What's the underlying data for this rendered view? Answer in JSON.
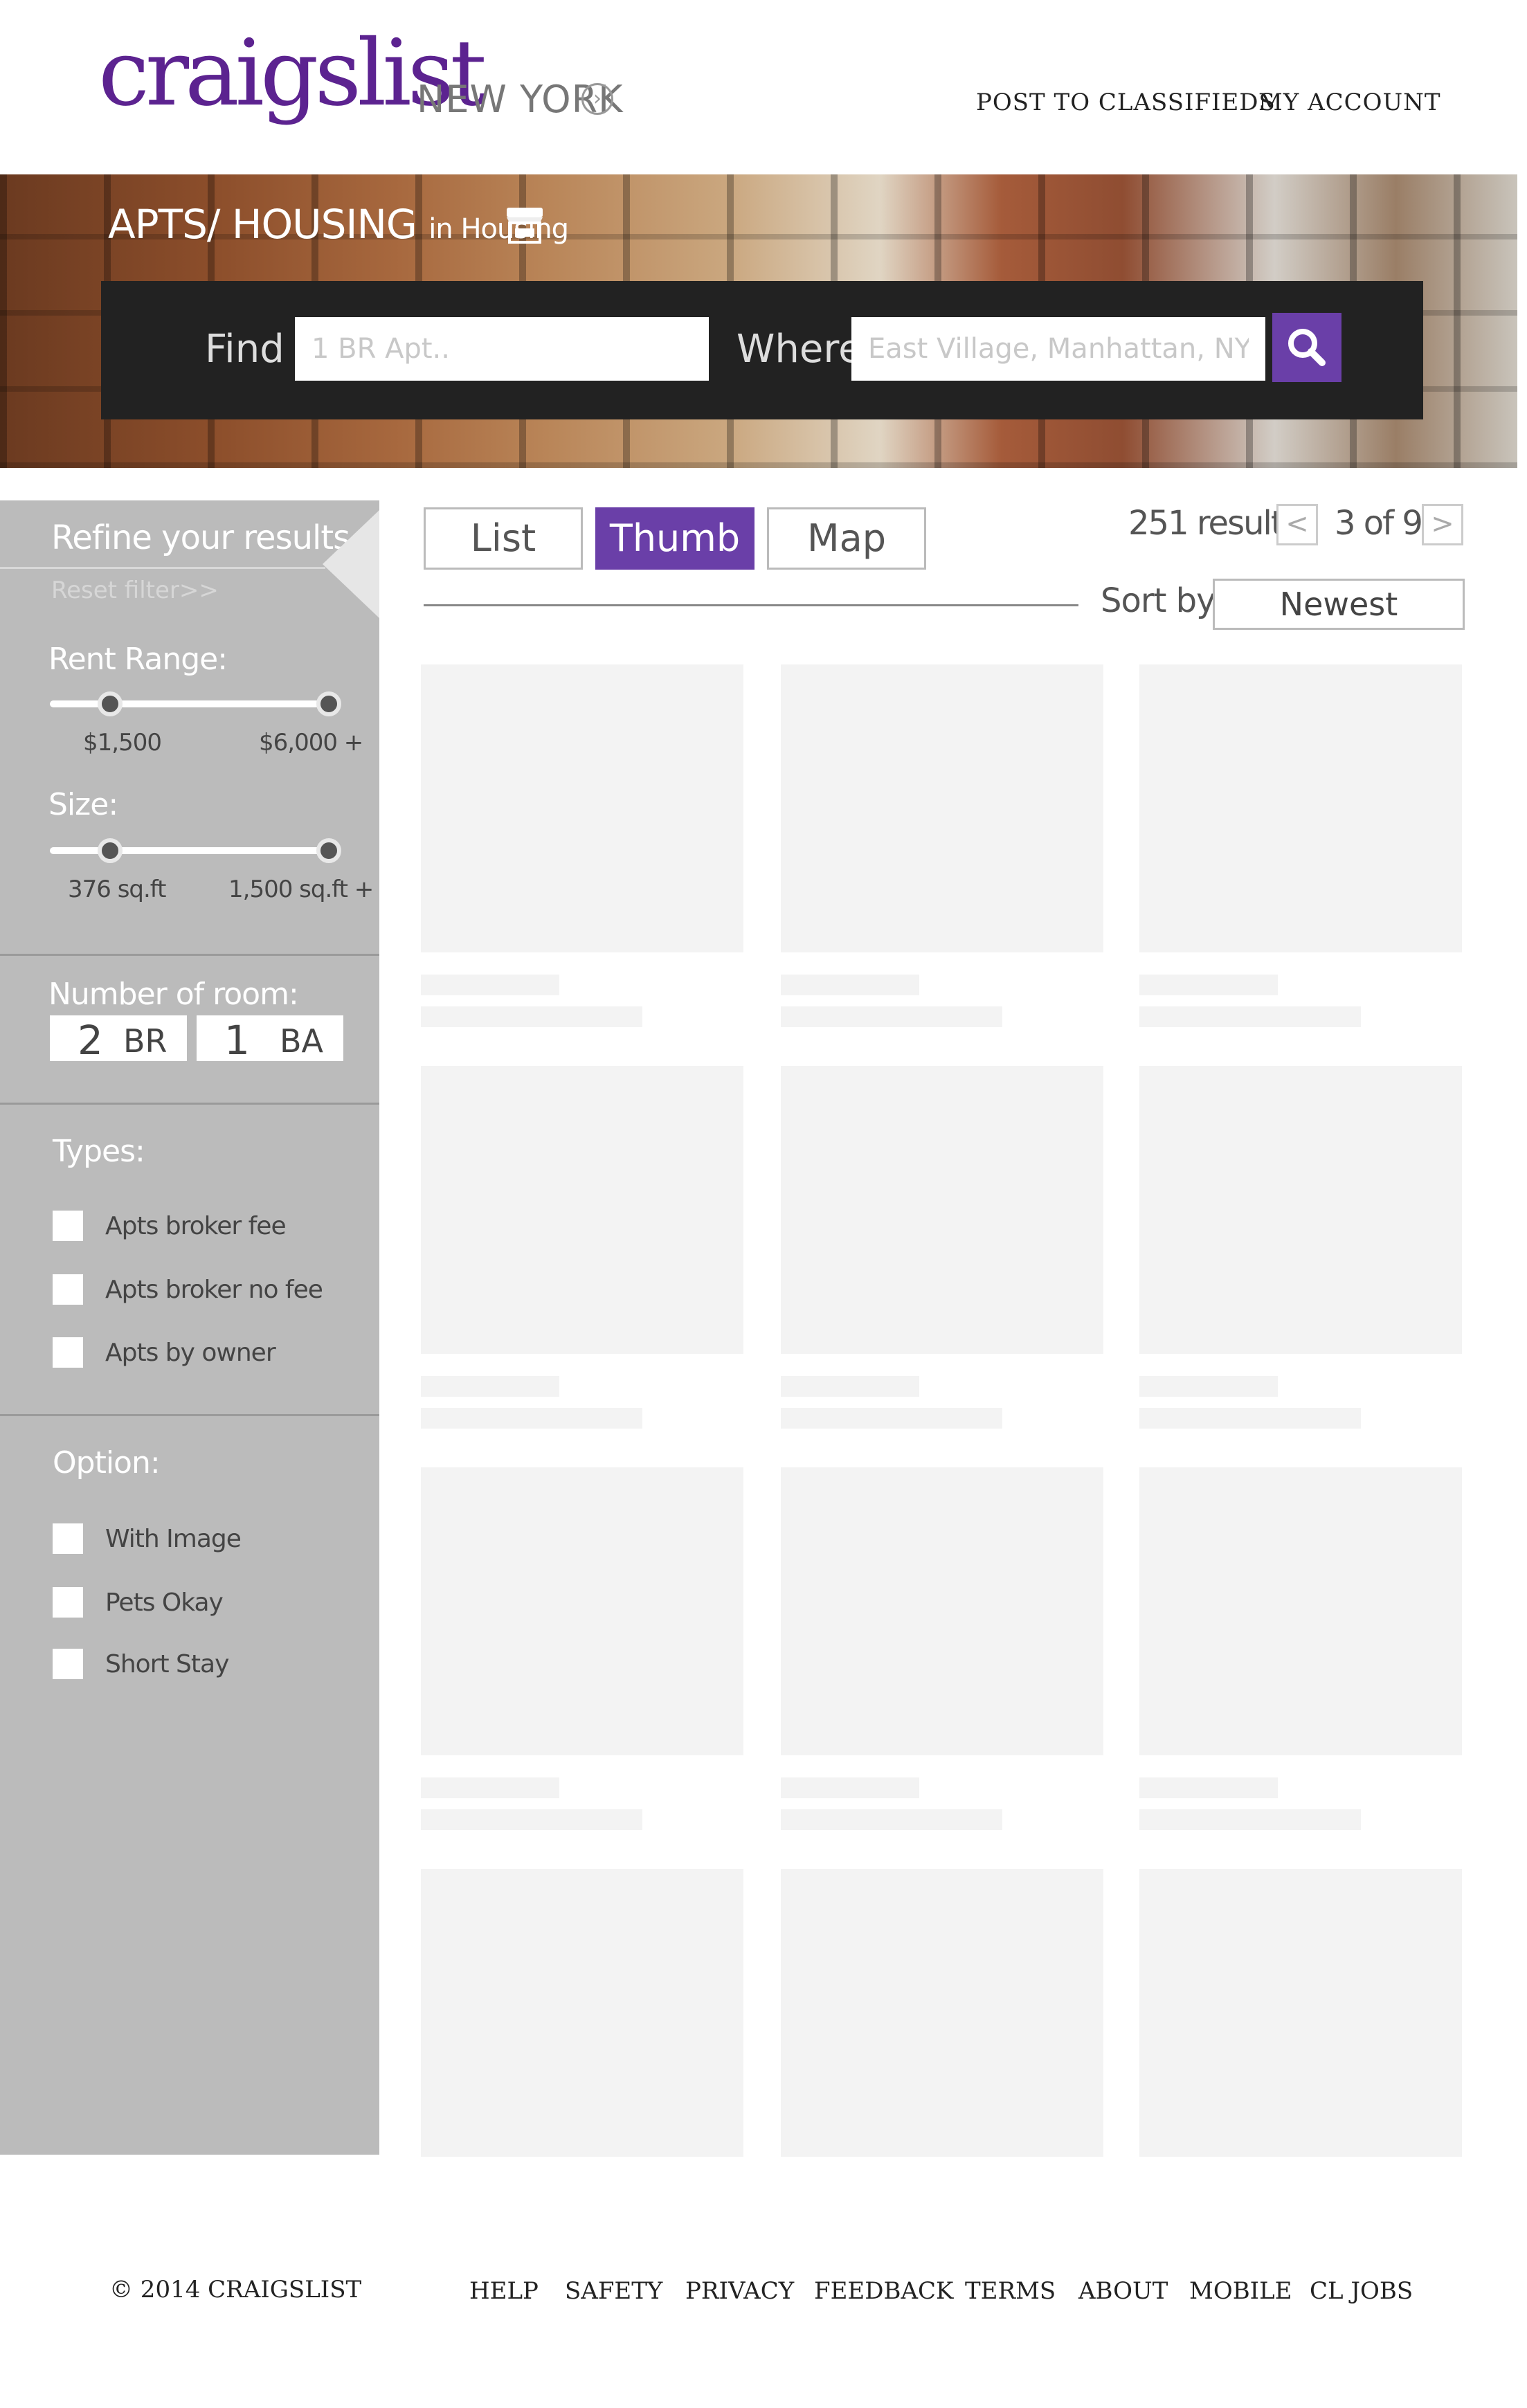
{
  "header": {
    "logo": "craigslist",
    "city": "NEW YORK",
    "city_chevron": "›",
    "links": [
      "POST TO CLASSIFIEDS",
      "MY ACCOUNT"
    ]
  },
  "hero": {
    "category": "APTS/ HOUSING",
    "in_label": "in Housing",
    "icon": "storefront-icon",
    "find_label": "Find",
    "find_placeholder": "1 BR Apt..",
    "where_label": "Where",
    "where_placeholder": "East Village, Manhattan, NY",
    "search_icon": "search-icon"
  },
  "sidebar": {
    "title": "Refine your results",
    "reset": "Reset filter>>",
    "rent": {
      "label": "Rent Range:",
      "min": "$1,500",
      "max": "$6,000 +"
    },
    "size": {
      "label": "Size:",
      "min": "376 sq.ft",
      "max": "1,500 sq.ft +"
    },
    "rooms": {
      "label": "Number of room:",
      "br_value": "2",
      "br_unit": "BR",
      "ba_value": "1",
      "ba_unit": "BA"
    },
    "types": {
      "label": "Types:",
      "items": [
        "Apts broker fee",
        "Apts broker no fee",
        "Apts by owner"
      ]
    },
    "options": {
      "label": "Option:",
      "items": [
        "With Image",
        "Pets Okay",
        "Short Stay"
      ]
    }
  },
  "results": {
    "views": [
      "List",
      "Thumb",
      "Map"
    ],
    "active_view": "Thumb",
    "count": "251 results",
    "prev": "<",
    "page": "3 of 9",
    "next": ">",
    "sort_label": "Sort by:",
    "sort_value": "Newest"
  },
  "footer": {
    "copyright": "© 2014 CRAIGSLIST",
    "links": [
      "HELP",
      "SAFETY",
      "PRIVACY",
      "FEEDBACK",
      "TERMS",
      "ABOUT",
      "MOBILE",
      "CL JOBS"
    ]
  },
  "colors": {
    "brand": "#5c2390",
    "accent": "#6a3fa8",
    "sidebar": "#bbbbbb",
    "placeholder": "#f3f3f3"
  }
}
